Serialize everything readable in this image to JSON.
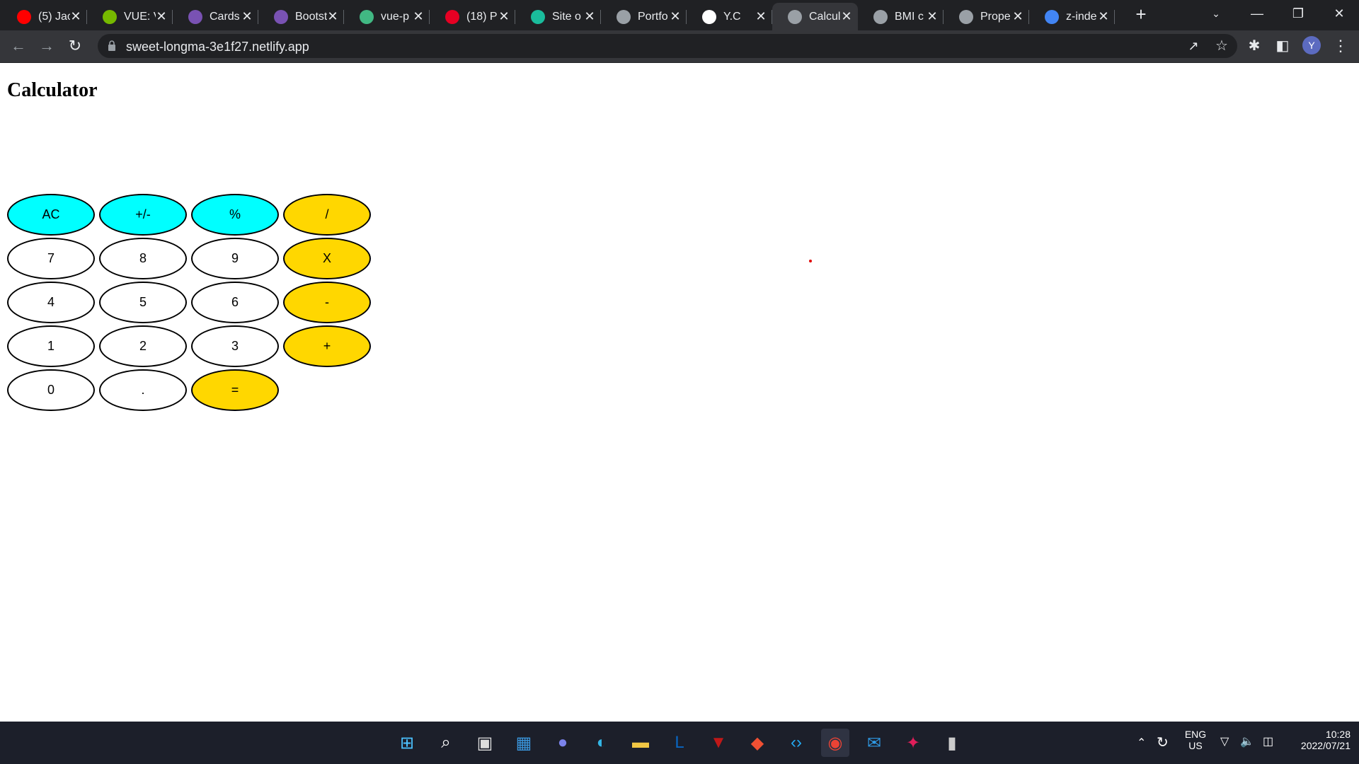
{
  "browser": {
    "tabs": [
      {
        "title": "(5) Jac",
        "icon": "youtube-icon",
        "color": "#ff0000"
      },
      {
        "title": "VUE: V",
        "icon": "nvidia-icon",
        "color": "#76b900"
      },
      {
        "title": "Cards",
        "icon": "bootstrap-icon",
        "color": "#7952b3"
      },
      {
        "title": "Bootst",
        "icon": "bootstrap-icon",
        "color": "#7952b3"
      },
      {
        "title": "vue-p",
        "icon": "vue-icon",
        "color": "#41b883"
      },
      {
        "title": "(18) P",
        "icon": "pinterest-icon",
        "color": "#e60023"
      },
      {
        "title": "Site o",
        "icon": "diamond-icon",
        "color": "#1abc9c"
      },
      {
        "title": "Portfo",
        "icon": "globe-icon",
        "color": "#9aa0a6"
      },
      {
        "title": "Y.C",
        "icon": "yc-icon",
        "color": "#ffffff"
      },
      {
        "title": "Calcul",
        "icon": "globe-icon",
        "color": "#9aa0a6",
        "active": true
      },
      {
        "title": "BMI c",
        "icon": "globe-icon",
        "color": "#9aa0a6"
      },
      {
        "title": "Prope",
        "icon": "globe-icon",
        "color": "#9aa0a6"
      },
      {
        "title": "z-inde",
        "icon": "google-icon",
        "color": "#4285f4"
      }
    ],
    "url": "sweet-longma-3e1f27.netlify.app",
    "profile_initial": "Y"
  },
  "page": {
    "title": "Calculator"
  },
  "calculator": {
    "keys": [
      {
        "label": "AC",
        "kind": "func"
      },
      {
        "label": "+/-",
        "kind": "func"
      },
      {
        "label": "%",
        "kind": "func"
      },
      {
        "label": "/",
        "kind": "op"
      },
      {
        "label": "7",
        "kind": "num"
      },
      {
        "label": "8",
        "kind": "num"
      },
      {
        "label": "9",
        "kind": "num"
      },
      {
        "label": "X",
        "kind": "op"
      },
      {
        "label": "4",
        "kind": "num"
      },
      {
        "label": "5",
        "kind": "num"
      },
      {
        "label": "6",
        "kind": "num"
      },
      {
        "label": "-",
        "kind": "op"
      },
      {
        "label": "1",
        "kind": "num"
      },
      {
        "label": "2",
        "kind": "num"
      },
      {
        "label": "3",
        "kind": "num"
      },
      {
        "label": "+",
        "kind": "op"
      },
      {
        "label": "0",
        "kind": "num"
      },
      {
        "label": ".",
        "kind": "num"
      },
      {
        "label": "=",
        "kind": "op"
      }
    ],
    "colors": {
      "func": "#00ffff",
      "op": "#ffd700",
      "num": "#ffffff"
    }
  },
  "taskbar": {
    "apps": [
      "windows-start-icon",
      "search-icon",
      "task-view-icon",
      "widgets-icon",
      "teams-chat-icon",
      "edge-icon",
      "file-explorer-icon",
      "linkedin-learning-icon",
      "mcafee-icon",
      "git-icon",
      "vscode-icon",
      "chrome-icon",
      "mail-icon",
      "slack-icon",
      "terminal-icon"
    ],
    "language": "ENG",
    "region": "US",
    "time": "10:28",
    "date": "2022/07/21"
  }
}
